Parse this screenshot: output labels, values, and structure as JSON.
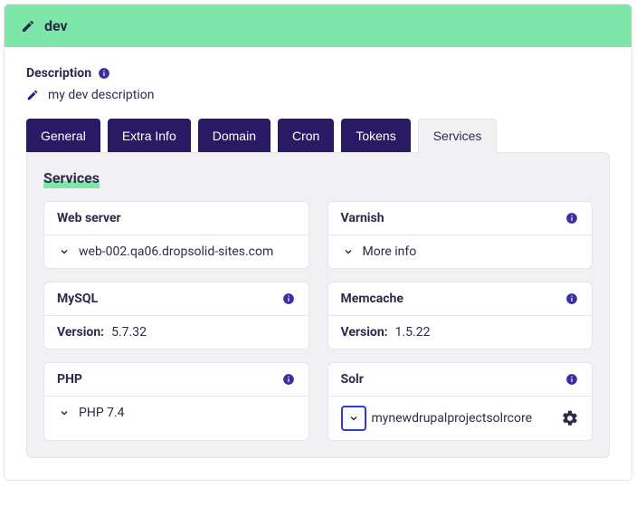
{
  "header": {
    "title": "dev"
  },
  "description": {
    "label": "Description",
    "text": "my dev description"
  },
  "tabs": {
    "items": [
      {
        "label": "General"
      },
      {
        "label": "Extra Info"
      },
      {
        "label": "Domain"
      },
      {
        "label": "Cron"
      },
      {
        "label": "Tokens"
      },
      {
        "label": "Services"
      }
    ],
    "activeIndex": 5
  },
  "panel": {
    "title": "Services"
  },
  "services": {
    "webserver": {
      "title": "Web server",
      "value": "web-002.qa06.dropsolid-sites.com"
    },
    "varnish": {
      "title": "Varnish",
      "value": "More info"
    },
    "mysql": {
      "title": "MySQL",
      "versionLabel": "Version:",
      "version": "5.7.32"
    },
    "memcache": {
      "title": "Memcache",
      "versionLabel": "Version:",
      "version": "1.5.22"
    },
    "php": {
      "title": "PHP",
      "value": "PHP 7.4"
    },
    "solr": {
      "title": "Solr",
      "value": "mynewdrupalprojectsolrcore"
    }
  }
}
